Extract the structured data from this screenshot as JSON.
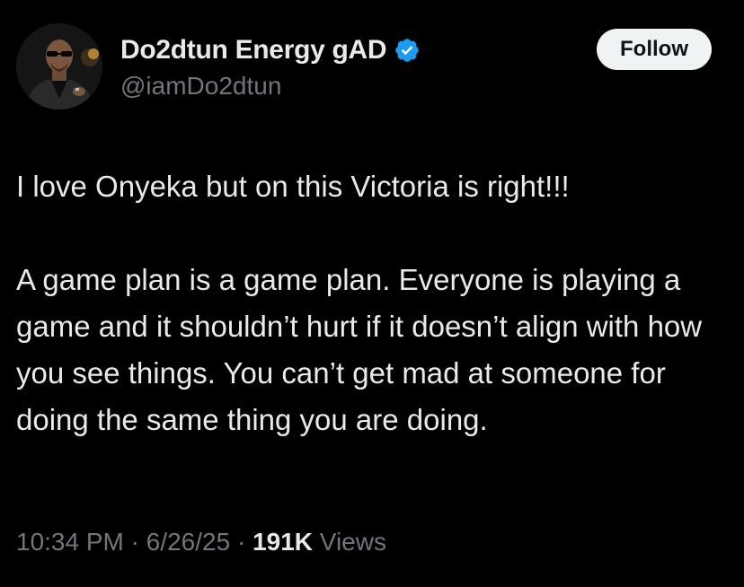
{
  "author": {
    "display_name": "Do2dtun Energy gAD",
    "handle": "@iamDo2dtun",
    "verified_icon": "verified-badge-icon",
    "avatar_icon": "profile-photo"
  },
  "follow_button": {
    "label": "Follow"
  },
  "tweet": {
    "text": "I love Onyeka but on this Victoria is right!!!\n\nA game plan is a game plan. Everyone is playing a game and it shouldn’t hurt if it doesn’t align with how you see things. You can’t get mad at someone for doing the same thing you are doing."
  },
  "meta": {
    "time": "10:34 PM",
    "sep1": " · ",
    "date": "6/26/25",
    "sep2": " · ",
    "views_count": "191K",
    "views_label": " Views"
  },
  "colors": {
    "background": "#000000",
    "primary_text": "#e7e9ea",
    "secondary_text": "#71767b",
    "verified_blue": "#1d9bf0",
    "button_bg": "#eff3f4"
  }
}
